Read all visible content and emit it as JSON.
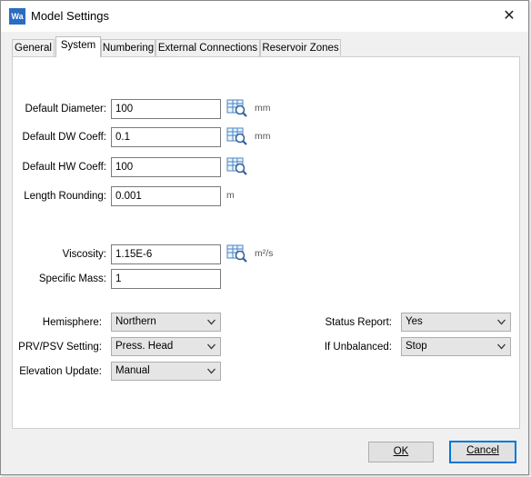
{
  "window": {
    "title": "Model Settings",
    "app_icon_text": "Wa",
    "close_glyph": "✕"
  },
  "tabs": [
    {
      "label": "General"
    },
    {
      "label": "System"
    },
    {
      "label": "Numbering"
    },
    {
      "label": "External Connections"
    },
    {
      "label": "Reservoir Zones"
    }
  ],
  "active_tab": "System",
  "fields": {
    "default_diameter": {
      "label": "Default Diameter:",
      "value": "100",
      "unit": "mm"
    },
    "default_dw_coeff": {
      "label": "Default DW Coeff:",
      "value": "0.1",
      "unit": "mm"
    },
    "default_hw_coeff": {
      "label": "Default HW Coeff:",
      "value": "100"
    },
    "length_rounding": {
      "label": "Length Rounding:",
      "value": "0.001",
      "unit": "m"
    },
    "viscosity": {
      "label": "Viscosity:",
      "value": "1.15E-6",
      "unit": "m²/s"
    },
    "specific_mass": {
      "label": "Specific Mass:",
      "value": "1"
    }
  },
  "dropdowns": {
    "hemisphere": {
      "label": "Hemisphere:",
      "value": "Northern"
    },
    "prv_psv_setting": {
      "label": "PRV/PSV Setting:",
      "value": "Press. Head"
    },
    "elevation_update": {
      "label": "Elevation Update:",
      "value": "Manual"
    },
    "status_report": {
      "label": "Status Report:",
      "value": "Yes"
    },
    "if_unbalanced": {
      "label": "If Unbalanced:",
      "value": "Stop"
    }
  },
  "buttons": {
    "ok": {
      "label": "OK"
    },
    "cancel": {
      "label": "Cancel"
    }
  },
  "icons": {
    "lookup": "table-magnifier-icon",
    "dropdown": "chevron-down-icon",
    "close": "close-icon",
    "app": "app-logo-icon"
  },
  "colors": {
    "accent": "#0078d7",
    "app_icon": "#2a6cc2"
  }
}
